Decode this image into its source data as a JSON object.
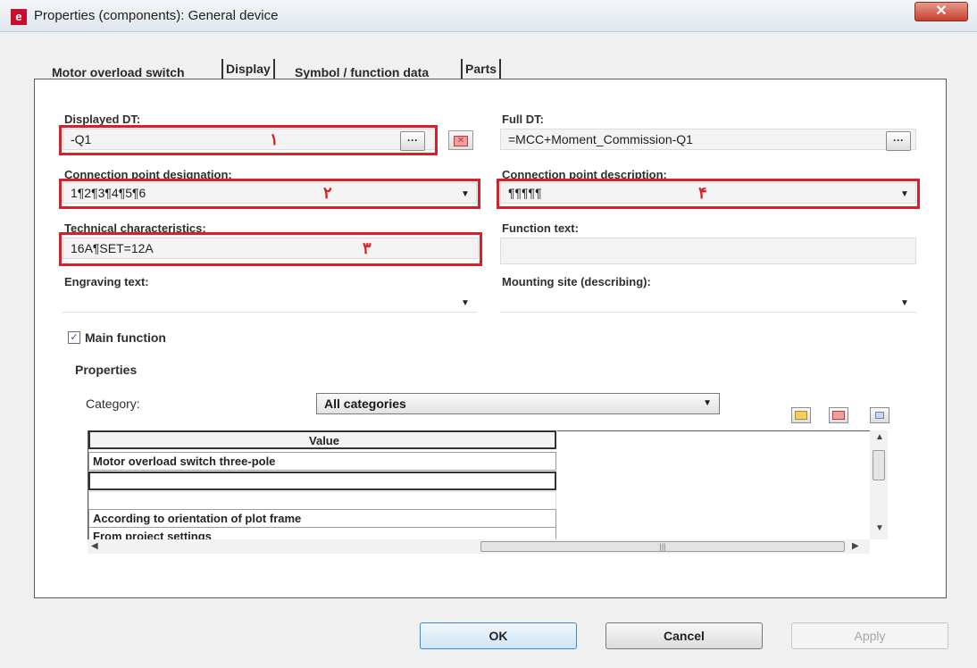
{
  "window": {
    "title": "Properties (components): General device",
    "icon": "e",
    "close_label": "✕"
  },
  "tabs": [
    {
      "label": "Motor overload switch",
      "active": true
    },
    {
      "label": "Display",
      "active": false
    },
    {
      "label": "Symbol / function data",
      "active": false
    },
    {
      "label": "Parts",
      "active": false
    }
  ],
  "fields": {
    "displayed_dt": {
      "label": "Displayed DT:",
      "value": "-Q1",
      "annotation": "۱"
    },
    "full_dt": {
      "label": "Full DT:",
      "value": "=MCC+Moment_Commission-Q1"
    },
    "connection_point_designation": {
      "label": "Connection point designation:",
      "value": "1¶2¶3¶4¶5¶6",
      "annotation": "۲"
    },
    "connection_point_description": {
      "label": "Connection point description:",
      "value": "¶¶¶¶¶",
      "annotation": "۴"
    },
    "technical_characteristics": {
      "label": "Technical characteristics:",
      "value": "16A¶SET=12A",
      "annotation": "۳"
    },
    "function_text": {
      "label": "Function text:",
      "value": ""
    },
    "engraving_text": {
      "label": "Engraving text:",
      "value": ""
    },
    "mounting_site": {
      "label": "Mounting site (describing):",
      "value": ""
    }
  },
  "main_function": {
    "label": "Main function",
    "checked": true
  },
  "properties": {
    "heading": "Properties",
    "category_label": "Category:",
    "category_value": "All categories",
    "grid": {
      "header": "Value",
      "rows": [
        "Motor overload switch three-pole",
        "",
        "",
        "According to orientation of plot frame",
        "From project settings"
      ]
    }
  },
  "buttons": {
    "ok": "OK",
    "cancel": "Cancel",
    "apply": "Apply"
  },
  "colors": {
    "annotation_red": "#d2222a",
    "accent_blue": "#3a8ad4"
  }
}
